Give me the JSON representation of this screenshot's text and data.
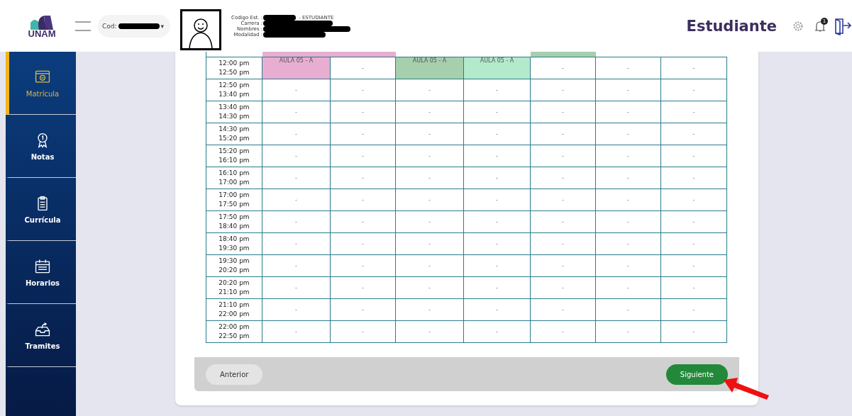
{
  "header": {
    "logo_text": "UNAM",
    "code_label": "Cod:",
    "code_caret": "▾",
    "info": [
      {
        "label": "Codigo Est. :",
        "suffix": "- ESTUDIANTE"
      },
      {
        "label": "Carrera :"
      },
      {
        "label": "Nombres :"
      },
      {
        "label": "Modalidad :"
      }
    ],
    "role": "Estudiante",
    "notification_count": "1"
  },
  "sidebar": {
    "items": [
      {
        "label": "Matrícula",
        "selected": true
      },
      {
        "label": "Notas",
        "selected": false
      },
      {
        "label": "Currícula",
        "selected": false
      },
      {
        "label": "Horarios",
        "selected": false
      },
      {
        "label": "Tramites",
        "selected": false
      }
    ]
  },
  "schedule": {
    "top_strip": [
      {
        "kind": "class",
        "color": "#e8aed1"
      },
      {
        "kind": "class",
        "color": "#e8aed1"
      },
      {
        "kind": "empty"
      },
      {
        "kind": "empty"
      },
      {
        "kind": "class",
        "color": "#a6cfae"
      },
      {
        "kind": "empty"
      },
      {
        "kind": "empty"
      }
    ],
    "rows": [
      {
        "time_start": "12:00 pm",
        "time_end": "12:50 pm",
        "cells": [
          {
            "text": "AULA 05 - A",
            "color": "#e8aed1"
          },
          {
            "text": "-"
          },
          {
            "text": "AULA 05 - A",
            "color": "#a6cfae"
          },
          {
            "text": "AULA 05 - A",
            "color": "#b2eacb"
          },
          {
            "text": "-"
          },
          {
            "text": "-"
          },
          {
            "text": "-"
          }
        ]
      },
      {
        "time_start": "12:50 pm",
        "time_end": "13:40 pm",
        "cells": [
          {
            "text": "-"
          },
          {
            "text": "-"
          },
          {
            "text": "-"
          },
          {
            "text": "-"
          },
          {
            "text": "-"
          },
          {
            "text": "-"
          },
          {
            "text": "-"
          }
        ]
      },
      {
        "time_start": "13:40 pm",
        "time_end": "14:30 pm",
        "cells": [
          {
            "text": "-"
          },
          {
            "text": "-"
          },
          {
            "text": "-"
          },
          {
            "text": "-"
          },
          {
            "text": "-"
          },
          {
            "text": "-"
          },
          {
            "text": "-"
          }
        ]
      },
      {
        "time_start": "14:30 pm",
        "time_end": "15:20 pm",
        "cells": [
          {
            "text": "-"
          },
          {
            "text": "-"
          },
          {
            "text": "-"
          },
          {
            "text": "-"
          },
          {
            "text": "-"
          },
          {
            "text": "-"
          },
          {
            "text": "-"
          }
        ]
      },
      {
        "time_start": "15:20 pm",
        "time_end": "16:10 pm",
        "cells": [
          {
            "text": "-"
          },
          {
            "text": "-"
          },
          {
            "text": "-"
          },
          {
            "text": "-"
          },
          {
            "text": "-"
          },
          {
            "text": "-"
          },
          {
            "text": "-"
          }
        ]
      },
      {
        "time_start": "16:10 pm",
        "time_end": "17:00 pm",
        "cells": [
          {
            "text": "-"
          },
          {
            "text": "-"
          },
          {
            "text": "-"
          },
          {
            "text": "-"
          },
          {
            "text": "-"
          },
          {
            "text": "-"
          },
          {
            "text": "-"
          }
        ]
      },
      {
        "time_start": "17:00 pm",
        "time_end": "17:50 pm",
        "cells": [
          {
            "text": "-"
          },
          {
            "text": "-"
          },
          {
            "text": "-"
          },
          {
            "text": "-"
          },
          {
            "text": "-"
          },
          {
            "text": "-"
          },
          {
            "text": "-"
          }
        ]
      },
      {
        "time_start": "17:50 pm",
        "time_end": "18:40 pm",
        "cells": [
          {
            "text": "-"
          },
          {
            "text": "-"
          },
          {
            "text": "-"
          },
          {
            "text": "-"
          },
          {
            "text": "-"
          },
          {
            "text": "-"
          },
          {
            "text": "-"
          }
        ]
      },
      {
        "time_start": "18:40 pm",
        "time_end": "19:30 pm",
        "cells": [
          {
            "text": "-"
          },
          {
            "text": "-"
          },
          {
            "text": "-"
          },
          {
            "text": "-"
          },
          {
            "text": "-"
          },
          {
            "text": "-"
          },
          {
            "text": "-"
          }
        ]
      },
      {
        "time_start": "19:30 pm",
        "time_end": "20:20 pm",
        "cells": [
          {
            "text": "-"
          },
          {
            "text": "-"
          },
          {
            "text": "-"
          },
          {
            "text": "-"
          },
          {
            "text": "-"
          },
          {
            "text": "-"
          },
          {
            "text": "-"
          }
        ]
      },
      {
        "time_start": "20:20 pm",
        "time_end": "21:10 pm",
        "cells": [
          {
            "text": "-"
          },
          {
            "text": "-"
          },
          {
            "text": "-"
          },
          {
            "text": "-"
          },
          {
            "text": "-"
          },
          {
            "text": "-"
          },
          {
            "text": "-"
          }
        ]
      },
      {
        "time_start": "21:10 pm",
        "time_end": "22:00 pm",
        "cells": [
          {
            "text": "-"
          },
          {
            "text": "-"
          },
          {
            "text": "-"
          },
          {
            "text": "-"
          },
          {
            "text": "-"
          },
          {
            "text": "-"
          },
          {
            "text": "-"
          }
        ]
      },
      {
        "time_start": "22:00 pm",
        "time_end": "22:50 pm",
        "cells": [
          {
            "text": "-"
          },
          {
            "text": "-"
          },
          {
            "text": "-"
          },
          {
            "text": "-"
          },
          {
            "text": "-"
          },
          {
            "text": "-"
          },
          {
            "text": "-"
          }
        ]
      }
    ]
  },
  "footer": {
    "back_button": "Anterior",
    "next_button": "Siguiente"
  }
}
